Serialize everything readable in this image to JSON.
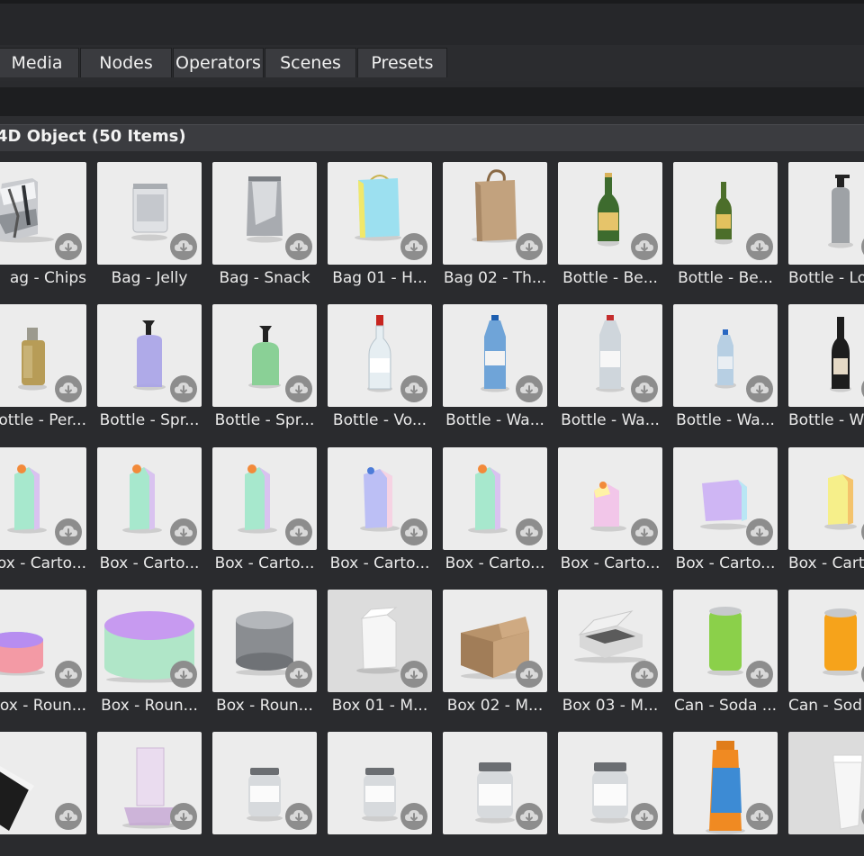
{
  "tabs": [
    {
      "label": "Media"
    },
    {
      "label": "Nodes"
    },
    {
      "label": "Operators"
    },
    {
      "label": "Scenes"
    },
    {
      "label": "Presets"
    }
  ],
  "section": {
    "title": "4D Object (50 Items)"
  },
  "icons": {
    "download": "download-cloud-icon"
  },
  "rows": [
    [
      {
        "label": "Bag - Chips",
        "shown": "ag - Chips",
        "kind": "bag_foil"
      },
      {
        "label": "Bag - Jelly",
        "kind": "bag_clear"
      },
      {
        "label": "Bag - Snack",
        "kind": "bag_snack"
      },
      {
        "label": "Bag 01 - H...",
        "kind": "shop_bag"
      },
      {
        "label": "Bag 02 - Th...",
        "kind": "paper_bag"
      },
      {
        "label": "Bottle - Be...",
        "kind": "beer"
      },
      {
        "label": "Bottle - Be...",
        "kind": "beer_small"
      },
      {
        "label": "Bottle - Lo...",
        "shown": "Bottle - Lo",
        "kind": "pump"
      }
    ],
    [
      {
        "label": "Bottle - Per...",
        "shown": "ottle - Per...",
        "kind": "perfume"
      },
      {
        "label": "Bottle - Spr...",
        "kind": "spray_purple"
      },
      {
        "label": "Bottle - Spr...",
        "kind": "spray_green"
      },
      {
        "label": "Bottle - Vo...",
        "kind": "vodka"
      },
      {
        "label": "Bottle - Wa...",
        "kind": "water_blue"
      },
      {
        "label": "Bottle - Wa...",
        "kind": "water_red"
      },
      {
        "label": "Bottle - Wa...",
        "kind": "water_small"
      },
      {
        "label": "Bottle - W...",
        "shown": "Bottle - W",
        "kind": "wine"
      }
    ],
    [
      {
        "label": "Box - Carto...",
        "shown": "ox - Carto...",
        "kind": "carton"
      },
      {
        "label": "Box - Carto...",
        "kind": "carton"
      },
      {
        "label": "Box - Carto...",
        "kind": "carton"
      },
      {
        "label": "Box - Carto...",
        "kind": "carton_blue"
      },
      {
        "label": "Box - Carto...",
        "kind": "carton"
      },
      {
        "label": "Box - Carto...",
        "kind": "carton_small"
      },
      {
        "label": "Box - Carto...",
        "kind": "carton_wide"
      },
      {
        "label": "Box - Carto...",
        "shown": "Box - Cart",
        "kind": "carton_yellow"
      }
    ],
    [
      {
        "label": "Box - Roun...",
        "shown": "ox - Roun...",
        "kind": "round_pink"
      },
      {
        "label": "Box - Roun...",
        "kind": "round_big"
      },
      {
        "label": "Box - Roun...",
        "kind": "tin"
      },
      {
        "label": "Box 01 - M...",
        "kind": "white_box",
        "dark": true
      },
      {
        "label": "Box 02 - M...",
        "kind": "cardboard"
      },
      {
        "label": "Box 03 - M...",
        "kind": "flat_box"
      },
      {
        "label": "Can - Soda ...",
        "kind": "can_green"
      },
      {
        "label": "Can - Soda ...",
        "shown": "Can - Sod",
        "kind": "can_orange"
      }
    ],
    [
      {
        "label": "",
        "kind": "folder"
      },
      {
        "label": "",
        "kind": "stand"
      },
      {
        "label": "",
        "kind": "jar"
      },
      {
        "label": "",
        "kind": "jar"
      },
      {
        "label": "",
        "kind": "jar_big"
      },
      {
        "label": "",
        "kind": "jar_big"
      },
      {
        "label": "",
        "kind": "bottle_orange"
      },
      {
        "label": "",
        "kind": "tube",
        "dark": true
      }
    ]
  ]
}
